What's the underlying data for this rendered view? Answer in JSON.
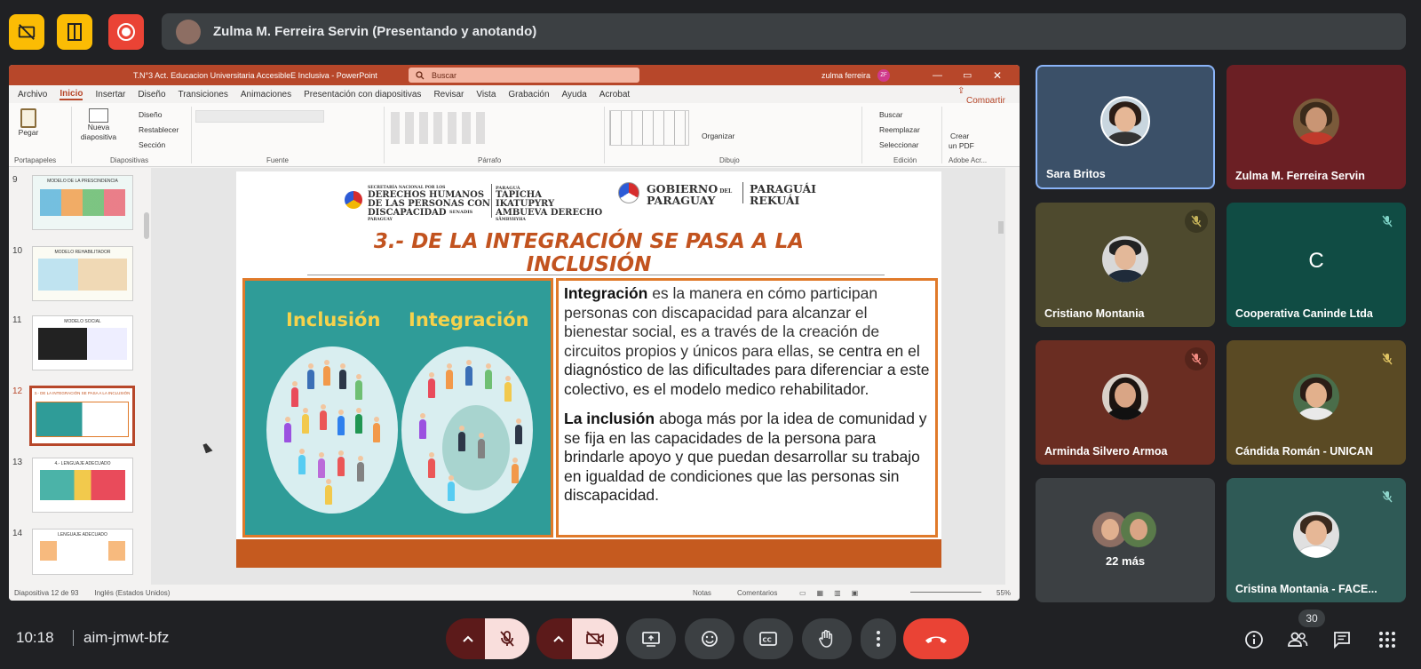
{
  "colors": {
    "accent_red": "#ea4335",
    "yellow": "#fbbc04",
    "bar_bg": "#3c4043",
    "ppt_red": "#b7472a"
  },
  "topbar": {
    "icons": [
      "no-camera-overlay-icon",
      "companion-icon",
      "recording-icon"
    ],
    "presenter": "Zulma M. Ferreira Servin (Presentando y anotando)"
  },
  "ppt": {
    "window_title": "T.N°3 Act. Educacion Universitaria AccesibleE Inclusiva  -  PowerPoint",
    "search": "Buscar",
    "user": "zulma ferreira",
    "user_initials": "ZF",
    "menu": [
      "Archivo",
      "Inicio",
      "Insertar",
      "Diseño",
      "Transiciones",
      "Animaciones",
      "Presentación con diapositivas",
      "Revisar",
      "Vista",
      "Grabación",
      "Ayuda",
      "Acrobat"
    ],
    "share": "Compartir",
    "ribbon": {
      "pegar": "Pegar",
      "nueva": "Nueva",
      "diapositiva": "diapositiva",
      "diseno": "Diseño",
      "restablecer": "Restablecer",
      "seccion": "Sección",
      "groups": [
        "Portapapeles",
        "Diapositivas",
        "Fuente",
        "Párrafo",
        "Dibujo",
        "Edición",
        "Adobe Acr..."
      ],
      "organizar": "Organizar",
      "buscar": "Buscar",
      "reemplazar": "Reemplazar",
      "seleccionar": "Seleccionar",
      "crear": "Crear",
      "crear2": "un PDF"
    },
    "thumb_numbers": [
      "9",
      "10",
      "11",
      "12",
      "13",
      "14"
    ],
    "thumb_titles": [
      "MODELO DE LA PRESCINDENCIA",
      "MODELO REHABILITADOR",
      "MODELO SOCIAL",
      "3.- DE LA INTEGRACIÓN SE PASA A LA INCLUSIÓN",
      "4.- LENGUAJE ADECUADO",
      "LENGUAJE ADECUADO"
    ],
    "status_left": "Diapositiva 12 de 93",
    "status_lang": "Inglés (Estados Unidos)",
    "status_notes": "Notas",
    "status_comments": "Comentarios",
    "zoom": "55%"
  },
  "slide": {
    "logo1_small": "SECRETARÍA NACIONAL POR LOS",
    "logo1_line1": "DERECHOS HUMANOS",
    "logo1_line2": "DE LAS PERSONAS CON",
    "logo1_line3": "DISCAPACIDAD",
    "logo1_senadis": "SENADIS",
    "logo1_country": "PARAGUAY",
    "logo2_small": "PARAGUÁ",
    "logo2_line1": "TAPICHA",
    "logo2_line2": "IKATUPYRY",
    "logo2_line3": "AMBUEVA DERECHO",
    "logo2_sub": "SÃMBYHYHA",
    "gob1": "GOBIERNO",
    "gob_del": "DEL",
    "gob2": "PARAGUAY",
    "rek1": "PARAGUÁI",
    "rek2": "REKUÁI",
    "title_line1": "3.- DE LA INTEGRACIÓN SE PASA A LA",
    "title_line2": "INCLUSIÓN",
    "img_label_left": "Inclusión",
    "img_label_right": "Integración",
    "p1_bold": "Integración",
    "p1_a": " es la manera en cómo participan personas con discapacidad para alcanzar el bienestar social, es a través de la creación de circuitos propios y únicos para ellas",
    "p1_b": ", se centra en el diagnóstico de las dificultades para diferenciar a este colectivo, es el modelo medico rehabilitador.",
    "p2_bold": "La inclusión",
    "p2_rest": " aboga más por la idea de comunidad y se fija en las capacidades de la persona para brindarle apoyo y que puedan desarrollar su trabajo en igualdad de condiciones que las personas sin discapacidad."
  },
  "participants": [
    {
      "name": "Sara Britos",
      "muted": false,
      "bg": "#3b5068",
      "avatar_bg": "#c9d6df",
      "speaking": true
    },
    {
      "name": "Zulma M. Ferreira Servin",
      "muted": false,
      "bg": "#6b1f24",
      "avatar_bg": "#7a5a3a"
    },
    {
      "name": "Cristiano Montania",
      "muted": true,
      "bg": "#4e4a2e",
      "avatar_bg": "#d8d8d8"
    },
    {
      "name": "Cooperativa Caninde Ltda",
      "muted": true,
      "bg": "#104c44",
      "initial": "C"
    },
    {
      "name": "Arminda Silvero Armoa",
      "muted": true,
      "bg": "#6a2d22",
      "avatar_bg": "#d9d0c8"
    },
    {
      "name": "Cándida Román - UNICAN",
      "muted": true,
      "bg": "#5a4a24",
      "avatar_bg": "#4a6d4a"
    },
    {
      "name": "22 más",
      "muted": false,
      "bg": "#3c4043"
    },
    {
      "name": "Cristina Montania - FACE...",
      "muted": true,
      "bg": "#2f5a56",
      "avatar_bg": "#e0e0e0"
    }
  ],
  "bottom": {
    "time": "10:18",
    "meeting_code": "aim-jmwt-bfz",
    "people_count": "30"
  }
}
